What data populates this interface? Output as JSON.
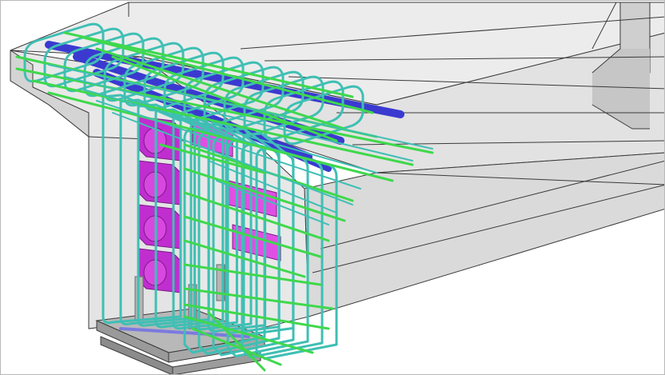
{
  "scene": {
    "kind": "3d-model-viewport",
    "subject": "reinforced-concrete-beam-end-with-rebar-and-anchors",
    "colors": {
      "background": "#ffffff",
      "concrete_light": "#ececec",
      "concrete_mid": "#dcdcdc",
      "concrete_dark": "#c4c4c4",
      "edge": "#3a3a3a",
      "stirrup": "#3fbfb4",
      "long_bar": "#3fd84c",
      "tendon": "#3a3ad0",
      "anchor_plate": "#c02ecf",
      "anchor_plate_light": "#e04fe4",
      "bearing": "#8a8a8a"
    }
  }
}
